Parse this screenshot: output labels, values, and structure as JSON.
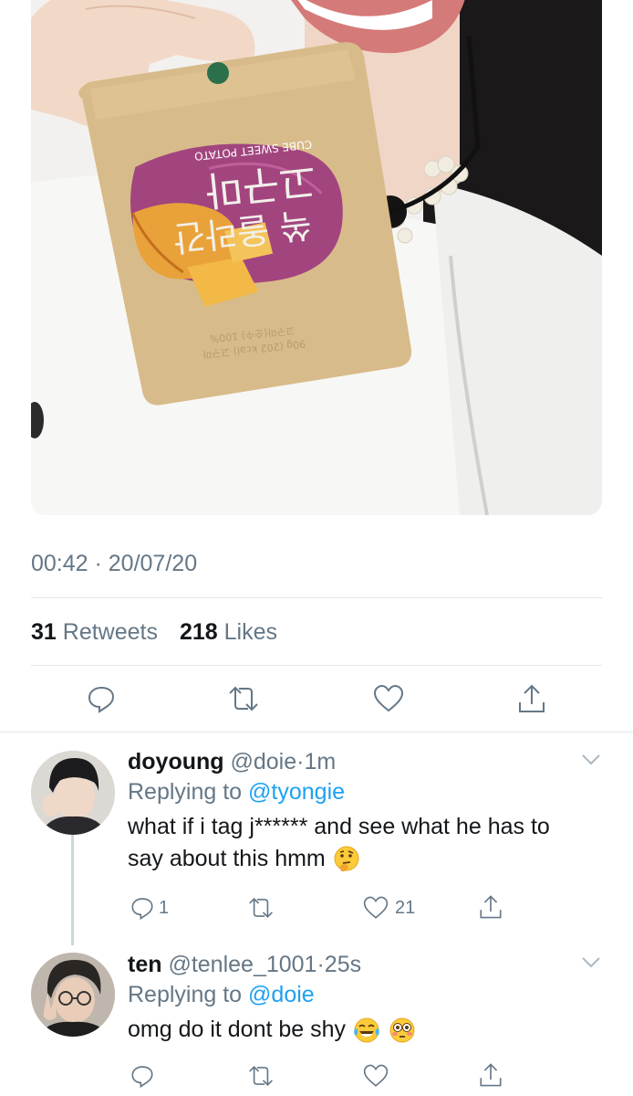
{
  "tweet": {
    "timestamp": "00:42 · 20/07/20",
    "retweets_count": "31",
    "retweets_label": "Retweets",
    "likes_count": "218",
    "likes_label": "Likes",
    "package_text": {
      "line1": "쏙 올라간",
      "line2": "고구마",
      "line3": "CUBE SWEET POTATO",
      "line4": "90g (202 kcal) 고구마",
      "line5": "고구마(순수) 100%"
    }
  },
  "replies": [
    {
      "name": "doyoung",
      "handle": "@doie",
      "time": "1m",
      "replying_prefix": "Replying to",
      "replying_to": "@tyongie",
      "text_line1": "what if i tag j****** and see what he has to",
      "text_line2": "say about this hmm",
      "emoji": "thinking-face",
      "reply_count": "1",
      "retweet_count": "",
      "like_count": "21"
    },
    {
      "name": "ten",
      "handle": "@tenlee_1001",
      "time": "25s",
      "replying_prefix": "Replying to",
      "replying_to": "@doie",
      "text_line1": "omg do it dont be shy",
      "emoji1": "tears-of-joy-face",
      "emoji2": "flushed-face",
      "reply_count": "",
      "retweet_count": "",
      "like_count": ""
    }
  ],
  "colors": {
    "accent": "#1da1f2",
    "secondary_text": "#657786",
    "divider": "#e1e8ed"
  }
}
